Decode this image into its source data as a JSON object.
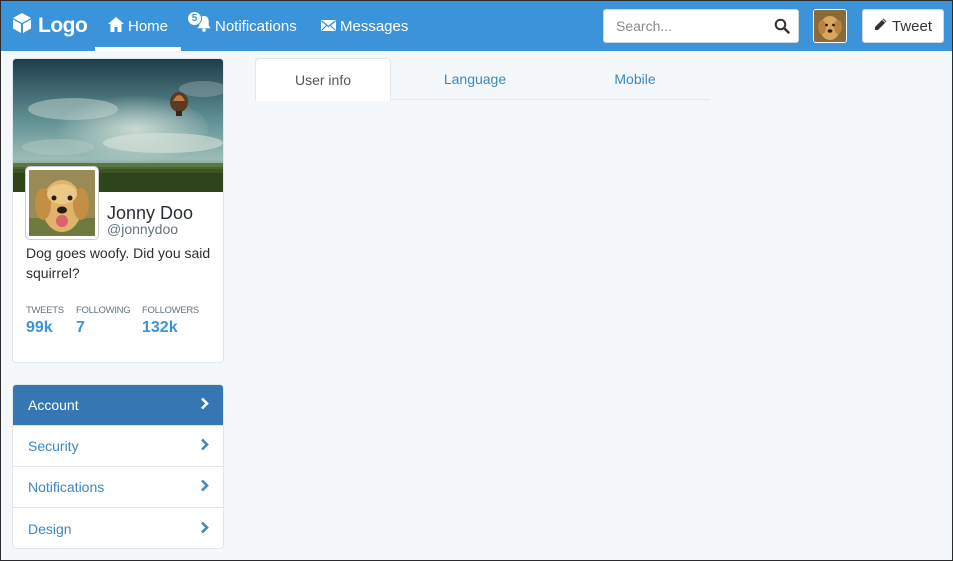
{
  "nav": {
    "logo": "Logo",
    "home": "Home",
    "notifications": "Notifications",
    "notifications_count": "5",
    "messages": "Messages",
    "search_placeholder": "Search...",
    "tweet_button": "Tweet",
    "icons": [
      "cube-icon",
      "home-icon",
      "bell-icon",
      "envelope-icon",
      "search-icon",
      "pencil-icon"
    ]
  },
  "profile": {
    "name": "Jonny Doo",
    "handle": "@jonnydoo",
    "bio": "Dog goes woofy. Did you said squirrel?",
    "stats": [
      {
        "label": "TWEETS",
        "value": "99k"
      },
      {
        "label": "FOLLOWING",
        "value": "7"
      },
      {
        "label": "FOLLOWERS",
        "value": "132k"
      }
    ]
  },
  "settings_menu": {
    "items": [
      {
        "label": "Account",
        "active": true
      },
      {
        "label": "Security",
        "active": false
      },
      {
        "label": "Notifications",
        "active": false
      },
      {
        "label": "Design",
        "active": false
      }
    ]
  },
  "tabs": [
    {
      "label": "User info",
      "active": true
    },
    {
      "label": "Language",
      "active": false
    },
    {
      "label": "Mobile",
      "active": false
    }
  ],
  "colors": {
    "brand_blue": "#3b94d9",
    "menu_active": "#3576b3",
    "link_blue": "#3b88c3",
    "page_bg": "#f5f8fa"
  }
}
